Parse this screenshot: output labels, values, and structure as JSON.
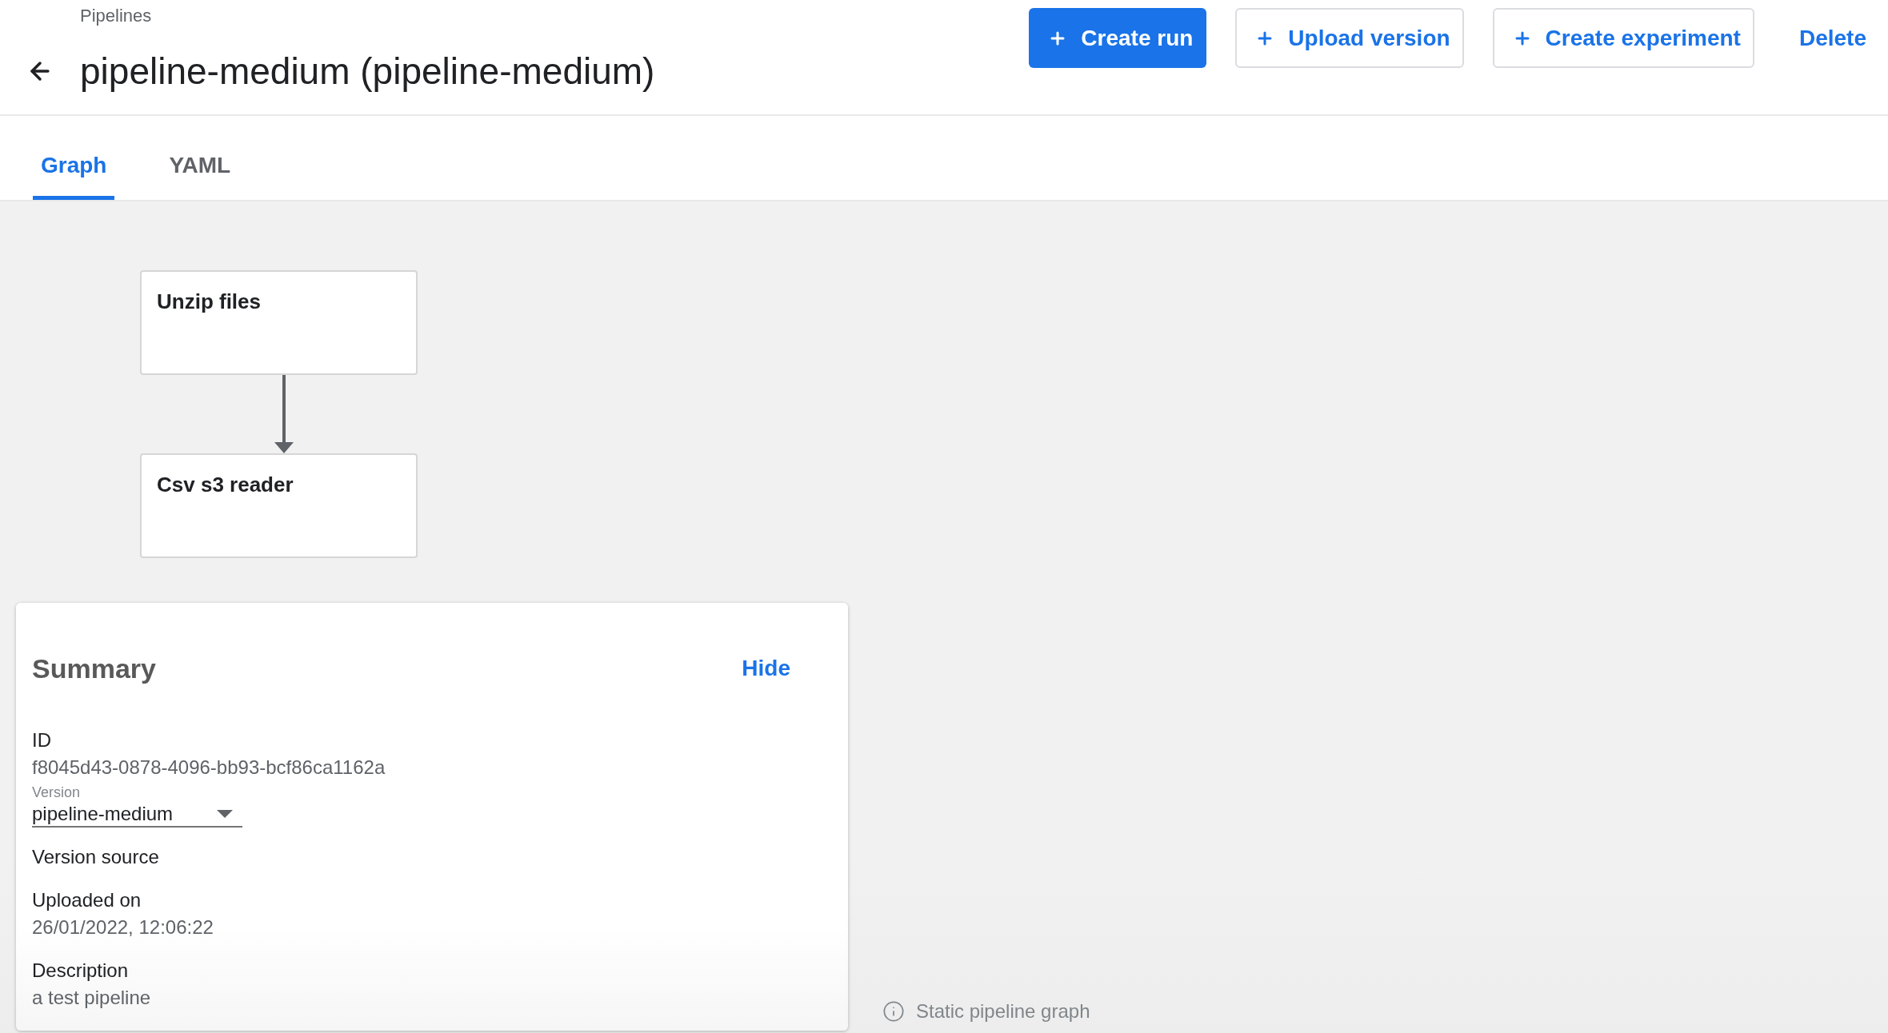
{
  "breadcrumb": "Pipelines",
  "title": "pipeline-medium (pipeline-medium)",
  "actions": [
    {
      "label": "Create run",
      "kind": "primary"
    },
    {
      "label": "Upload version",
      "kind": "outlined"
    },
    {
      "label": "Create experiment",
      "kind": "outlined"
    },
    {
      "label": "Delete",
      "kind": "text"
    }
  ],
  "tabs": [
    {
      "label": "Graph",
      "selected": true
    },
    {
      "label": "YAML",
      "selected": false
    }
  ],
  "graph": {
    "nodes": [
      {
        "label": "Unzip files",
        "children": [
          {
            "label": "Csv s3 reader"
          }
        ]
      }
    ],
    "caption": "Static pipeline graph"
  },
  "summary": {
    "title": "Summary",
    "hide": "Hide",
    "fields": [
      {
        "kind": "text",
        "label": "ID",
        "value": "f8045d43-0878-4096-bb93-bcf86ca1162a"
      },
      {
        "kind": "select",
        "label": "Version",
        "value": "pipeline-medium"
      },
      {
        "kind": "text",
        "label": "Version source"
      },
      {
        "kind": "text",
        "label": "Uploaded on",
        "value": "26/01/2022, 12:06:22"
      },
      {
        "kind": "text",
        "label": "Description",
        "value": "a test pipeline"
      }
    ]
  }
}
